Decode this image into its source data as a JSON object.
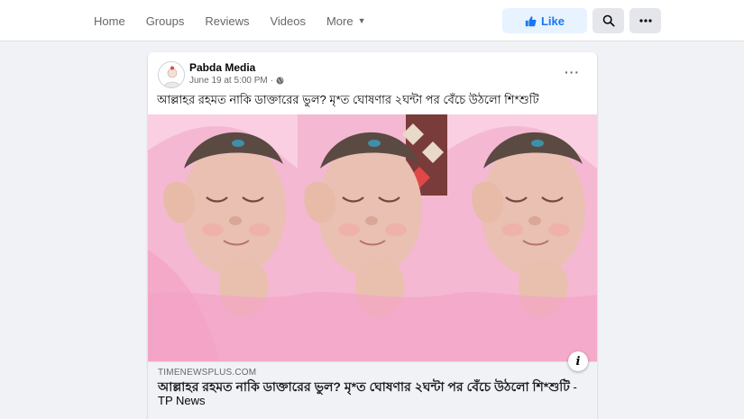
{
  "nav": {
    "items": [
      {
        "label": "Home"
      },
      {
        "label": "Groups"
      },
      {
        "label": "Reviews"
      },
      {
        "label": "Videos"
      },
      {
        "label": "More"
      }
    ],
    "like_label": "Like",
    "icons": {
      "like": "thumbs-up-icon",
      "search": "search-icon",
      "more": "more-options-icon"
    }
  },
  "post": {
    "author": "Pabda Media",
    "date": "June 19 at 5:00 PM",
    "separator": "·",
    "privacy_icon": "globe-icon",
    "more_label": "···",
    "caption": "আল্লাহর রহমত নাকি ডাক্তারের ভুল? মৃ*ত ঘোষণার ২ঘন্টা পর বেঁচে উঠলো শি*শুটি",
    "media_description_icon": "baby-photo-triptych"
  },
  "link_preview": {
    "domain": "TIMENEWSPLUS.COM",
    "title": "আল্লাহর রহমত নাকি ডাক্তারের ভুল? মৃ*ত ঘোষণার ২ঘন্টা পর বেঁচে উঠলো শি*শুটি",
    "title_suffix": " - TP News",
    "info_label": "i"
  },
  "colors": {
    "accent": "#1877f2",
    "like_bg": "#e7f3ff",
    "page_bg": "#f0f2f5"
  }
}
